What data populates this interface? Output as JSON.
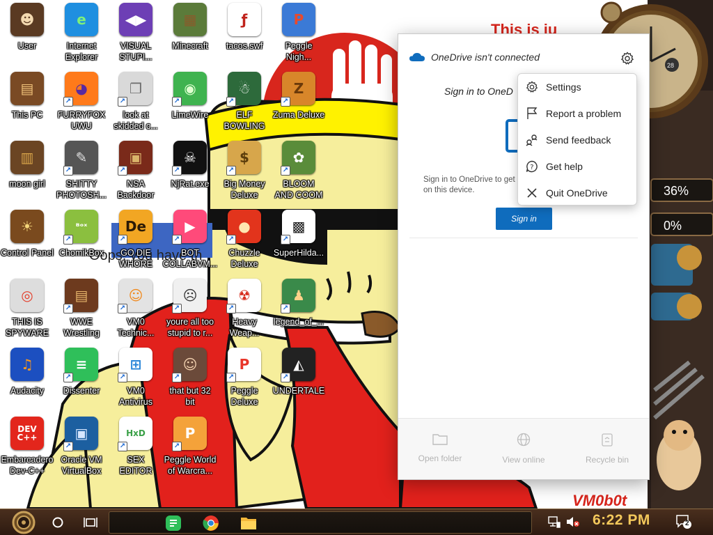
{
  "desktop": {
    "icons": [
      {
        "label": "User",
        "glyph": "☻",
        "bg": "#5a3a22",
        "fg": "#f3d9b0"
      },
      {
        "label": "Internet\nExplorer",
        "glyph": "e",
        "bg": "#1f8fe0",
        "fg": "#7ef07a"
      },
      {
        "label": "VISUAL\nSTUPI...",
        "glyph": "◀▶",
        "bg": "#6d3fb5",
        "fg": "#ffffff"
      },
      {
        "label": "Minecraft",
        "glyph": "▦",
        "bg": "#5b7b3a",
        "fg": "#8b5a2b"
      },
      {
        "label": "tacos.swf",
        "glyph": "ƒ",
        "bg": "#ffffff",
        "fg": "#c0231c"
      },
      {
        "label": "Peggle\nNigh...",
        "glyph": "P",
        "bg": "#3b7ad6",
        "fg": "#e84a2c"
      },
      {
        "label": "This PC",
        "glyph": "▤",
        "bg": "#7a4a24",
        "fg": "#f0c27a"
      },
      {
        "label": "FURRYFOX\nUWU",
        "glyph": "◕",
        "bg": "#ff7a1a",
        "fg": "#5a2aa0"
      },
      {
        "label": "look at\nskidded c...",
        "glyph": "❐",
        "bg": "#d9d9d9",
        "fg": "#6b6b6b"
      },
      {
        "label": "LimeWire",
        "glyph": "◉",
        "bg": "#3fb34f",
        "fg": "#dfffd0"
      },
      {
        "label": "ELF\nBOWLING",
        "glyph": "☃",
        "bg": "#2d6a3b",
        "fg": "#ffffff"
      },
      {
        "label": "Zuma Deluxe",
        "glyph": "Z",
        "bg": "#d8862a",
        "fg": "#6b3a0a"
      },
      {
        "label": "moon girl",
        "glyph": "▥",
        "bg": "#6b4523",
        "fg": "#d9a54a"
      },
      {
        "label": "SHITTY\nPHOTOSH...",
        "glyph": "✎",
        "bg": "#555555",
        "fg": "#e0e0e0"
      },
      {
        "label": "NSA\nBackdoor",
        "glyph": "▣",
        "bg": "#7a2a1a",
        "fg": "#d9b36a"
      },
      {
        "label": "NjRat.exe",
        "glyph": "☠",
        "bg": "#111111",
        "fg": "#ffffff"
      },
      {
        "label": "Big Money\nDeluxe",
        "glyph": "$",
        "bg": "#d7a64b",
        "fg": "#5b3c0b"
      },
      {
        "label": "BLOOM\nAND COOM",
        "glyph": "✿",
        "bg": "#5a8c3a",
        "fg": "#ffffff"
      },
      {
        "label": "Control Panel",
        "glyph": "☀",
        "bg": "#7a4a1e",
        "fg": "#f4d67a"
      },
      {
        "label": "ChomikBox",
        "glyph": "ᴮᵒˣ",
        "bg": "#8bbf3f",
        "fg": "#ffffff"
      },
      {
        "label": "GO DIE\nWHORE",
        "glyph": "De",
        "bg": "#f2a623",
        "fg": "#2b1a06"
      },
      {
        "label": "BOT\nCOLLABVM...",
        "glyph": "▶",
        "bg": "#ff4a7a",
        "fg": "#ffffff"
      },
      {
        "label": "Chuzzle\nDeluxe",
        "glyph": "●",
        "bg": "#e2341c",
        "fg": "#ffe7b0"
      },
      {
        "label": "SuperHilda...",
        "glyph": "▩",
        "bg": "#ffffff",
        "fg": "#222222"
      },
      {
        "label": "THIS IS\nSPYWARE",
        "glyph": "◎",
        "bg": "#dddddd",
        "fg": "#e43e2b"
      },
      {
        "label": "WWE\nWrestling",
        "glyph": "▤",
        "bg": "#6d3a1e",
        "fg": "#e6b56b"
      },
      {
        "label": "VM0\nTechnic...",
        "glyph": "☺",
        "bg": "#e3e3e3",
        "fg": "#f08a1e"
      },
      {
        "label": "youre all too\nstupid to r...",
        "glyph": "☹",
        "bg": "#f0f0f0",
        "fg": "#333333"
      },
      {
        "label": "Heavy\nWeap...",
        "glyph": "☢",
        "bg": "#ffffff",
        "fg": "#d62a1a"
      },
      {
        "label": "legend_of_...",
        "glyph": "♟",
        "bg": "#3a8a4a",
        "fg": "#ffd28a"
      },
      {
        "label": "Audacity",
        "glyph": "♫",
        "bg": "#1c4fc0",
        "fg": "#ff9a1a"
      },
      {
        "label": "Dissenter",
        "glyph": "≡",
        "bg": "#2fbf5a",
        "fg": "#ffffff"
      },
      {
        "label": "VM0\nAntivirus",
        "glyph": "⊞",
        "bg": "#ffffff",
        "fg": "#2a86d8"
      },
      {
        "label": "that but 32\nbit",
        "glyph": "☺",
        "bg": "#6b4a3a",
        "fg": "#f3d2b0"
      },
      {
        "label": "Peggle\nDeluxe",
        "glyph": "P",
        "bg": "#ffffff",
        "fg": "#e8362a"
      },
      {
        "label": "UNDERTALE",
        "glyph": "◭",
        "bg": "#222222",
        "fg": "#ffffff"
      },
      {
        "label": "Embarcadero\nDev-C++",
        "glyph": "DEV\nC++",
        "bg": "#e3261c",
        "fg": "#ffffff"
      },
      {
        "label": "Oracle VM\nVirtualBox",
        "glyph": "▣",
        "bg": "#1c5fa0",
        "fg": "#d6e6ff"
      },
      {
        "label": "SEX\nEDITOR",
        "glyph": "HxD",
        "bg": "#ffffff",
        "fg": "#3aa047"
      },
      {
        "label": "Peggle World\nof Warcra...",
        "glyph": "P",
        "bg": "#f4a23a",
        "fg": "#ffffff"
      }
    ]
  },
  "onedrive": {
    "title": "OneDrive isn't connected",
    "signin_title": "Sign in to OneD",
    "description": "Sign in to OneDrive to get\non this device.",
    "signin_button": "Sign in",
    "footer": {
      "open_folder": "Open folder",
      "view_online": "View online",
      "recycle_bin": "Recycle bin"
    },
    "menu": [
      {
        "label": "Settings",
        "icon": "gear-icon"
      },
      {
        "label": "Report a problem",
        "icon": "flag-icon"
      },
      {
        "label": "Send feedback",
        "icon": "feedback-icon"
      },
      {
        "label": "Get help",
        "icon": "help-icon"
      },
      {
        "label": "Quit OneDrive",
        "icon": "close-icon"
      }
    ],
    "accent": "#0f6cbd"
  },
  "wallpaper": {
    "red_banner_text": "This is ju",
    "partial_text": "Oops, you have th",
    "gauge_top": "36%",
    "gauge_bottom": "0%",
    "clock_badge": "28",
    "watermark": "VM0b0t"
  },
  "taskbar": {
    "clock": "6:22 PM",
    "notification_count": "2",
    "clock_color": "#f3c85b"
  }
}
